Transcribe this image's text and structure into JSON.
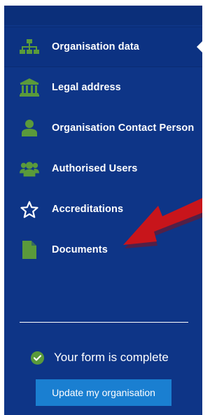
{
  "nav": {
    "items": [
      {
        "label": "Organisation data",
        "icon": "sitemap-icon",
        "active": true
      },
      {
        "label": "Legal address",
        "icon": "bank-icon"
      },
      {
        "label": "Organisation Contact Person",
        "icon": "user-icon"
      },
      {
        "label": "Authorised Users",
        "icon": "users-icon"
      },
      {
        "label": "Accreditations",
        "icon": "star-icon"
      },
      {
        "label": "Documents",
        "icon": "document-icon"
      }
    ]
  },
  "status": {
    "text": "Your form is complete",
    "icon": "check-circle-icon"
  },
  "actions": {
    "update_label": "Update my organisation"
  },
  "colors": {
    "sidebar": "#0e3587",
    "icon_green": "#5a9a3b",
    "button": "#1a7fd1",
    "arrow": "#c8151b"
  }
}
